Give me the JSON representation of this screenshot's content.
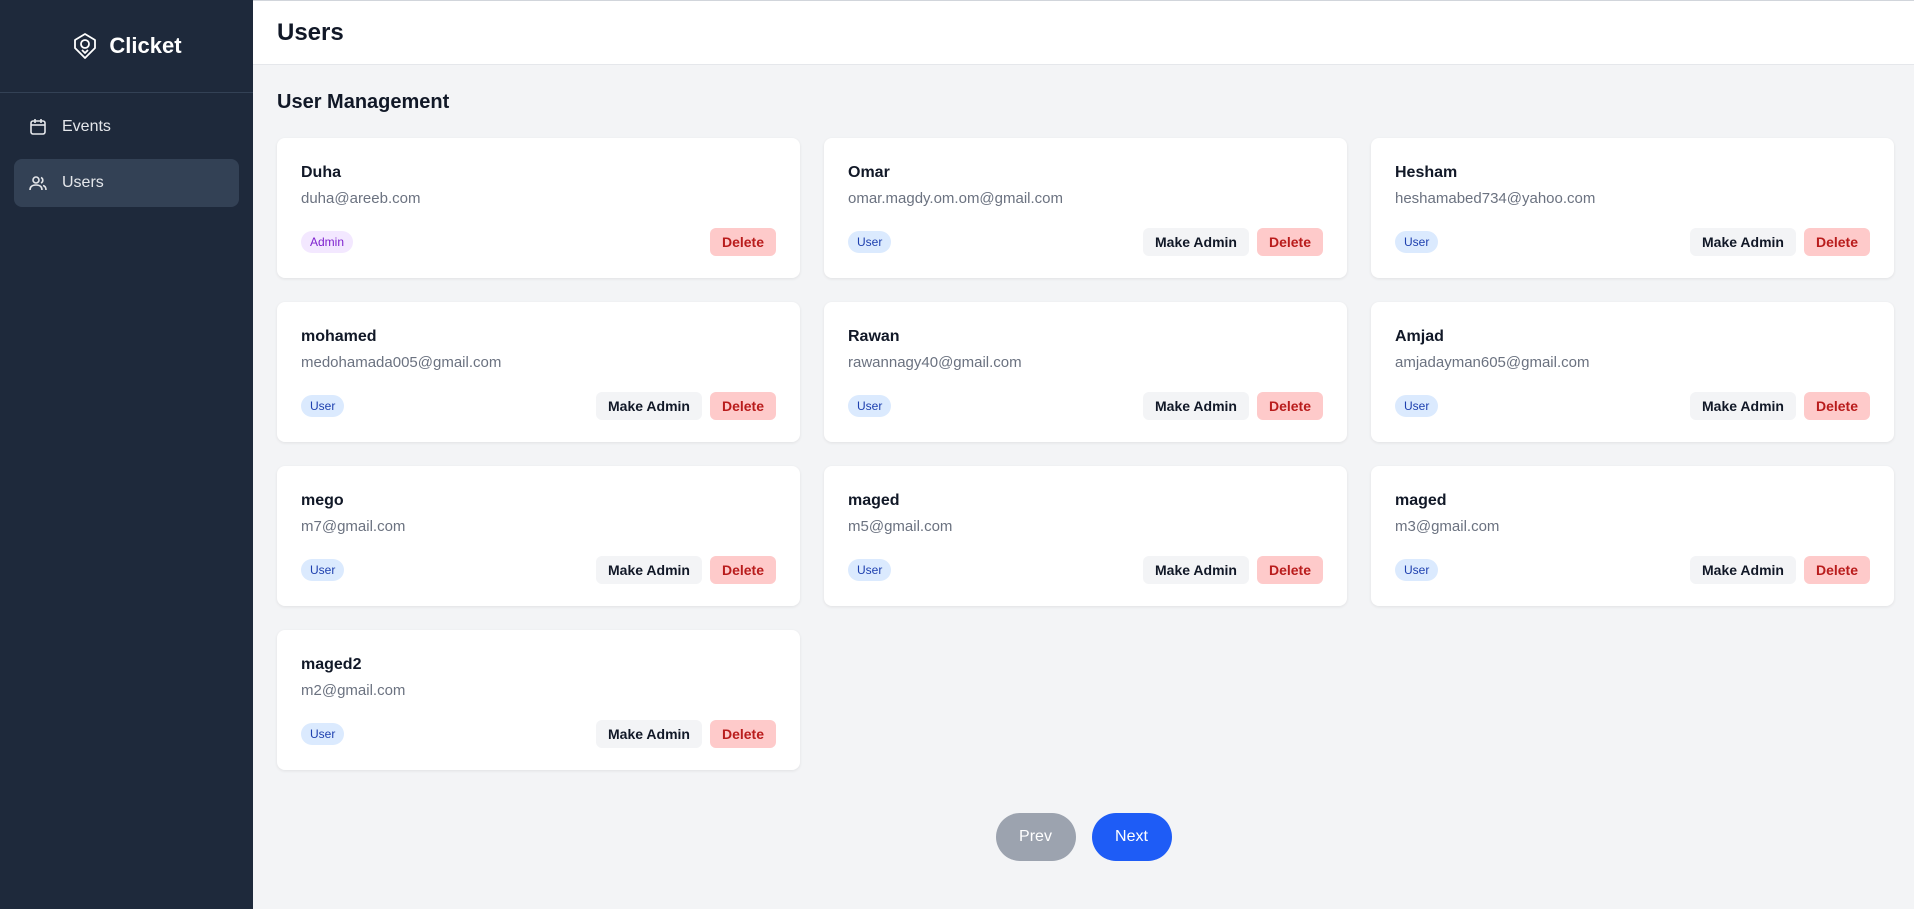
{
  "brand": {
    "name": "Clicket"
  },
  "sidebar": {
    "items": [
      {
        "label": "Events",
        "icon": "calendar-icon",
        "active": false
      },
      {
        "label": "Users",
        "icon": "users-icon",
        "active": true
      }
    ]
  },
  "header": {
    "title": "Users"
  },
  "main": {
    "section_title": "User Management",
    "make_admin_label": "Make Admin",
    "delete_label": "Delete",
    "users": [
      {
        "name": "Duha",
        "email": "duha@areeb.com",
        "role": "Admin"
      },
      {
        "name": "Omar",
        "email": "omar.magdy.om.om@gmail.com",
        "role": "User"
      },
      {
        "name": "Hesham",
        "email": "heshamabed734@yahoo.com",
        "role": "User"
      },
      {
        "name": "mohamed",
        "email": "medohamada005@gmail.com",
        "role": "User"
      },
      {
        "name": "Rawan",
        "email": "rawannagy40@gmail.com",
        "role": "User"
      },
      {
        "name": "Amjad",
        "email": "amjadayman605@gmail.com",
        "role": "User"
      },
      {
        "name": "mego",
        "email": "m7@gmail.com",
        "role": "User"
      },
      {
        "name": "maged",
        "email": "m5@gmail.com",
        "role": "User"
      },
      {
        "name": "maged",
        "email": "m3@gmail.com",
        "role": "User"
      },
      {
        "name": "maged2",
        "email": "m2@gmail.com",
        "role": "User"
      }
    ]
  },
  "pagination": {
    "prev_label": "Prev",
    "next_label": "Next"
  },
  "colors": {
    "sidebar_bg": "#1e293b",
    "accent": "#1e5cf6",
    "delete_bg": "#fecaca"
  }
}
